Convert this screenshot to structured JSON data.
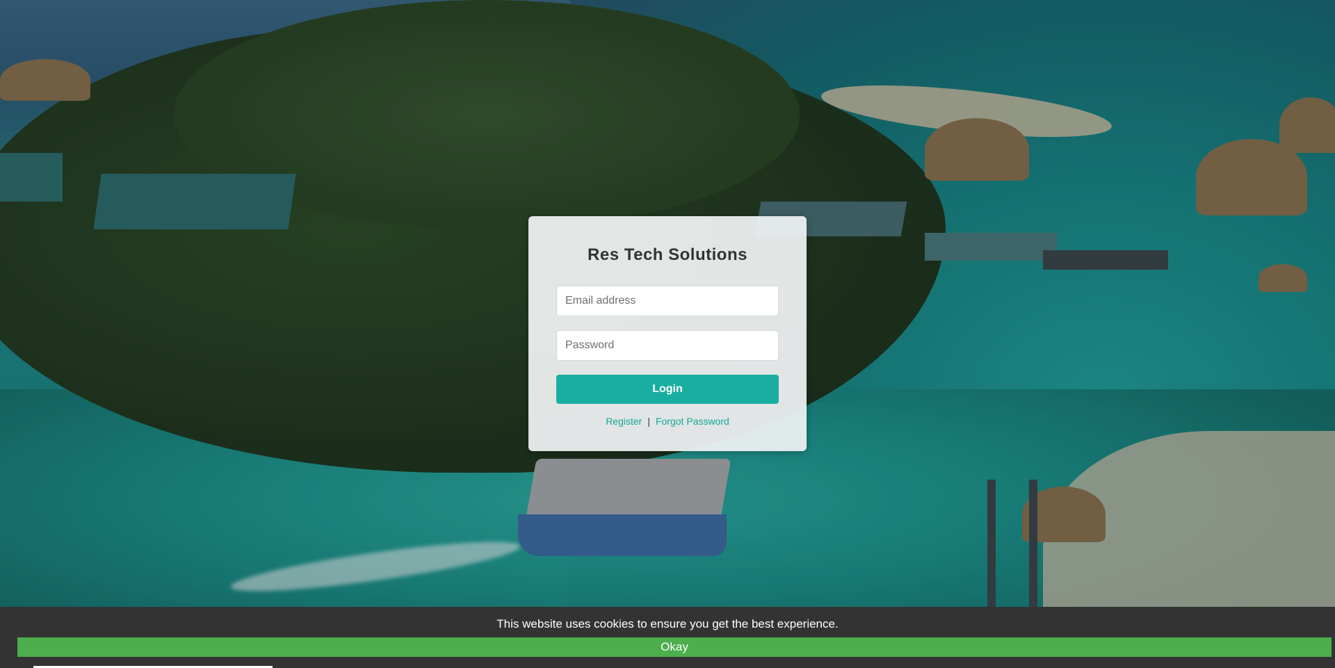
{
  "login": {
    "title": "Res Tech Solutions",
    "email_placeholder": "Email address",
    "password_placeholder": "Password",
    "login_label": "Login",
    "register_label": "Register",
    "separator": "|",
    "forgot_label": "Forgot Password"
  },
  "cookie": {
    "message": "This website uses cookies to ensure you get the best experience.",
    "okay_label": "Okay"
  },
  "colors": {
    "accent": "#1aaea1",
    "cookie_button": "#4cae4c",
    "cookie_bar": "#333333"
  }
}
